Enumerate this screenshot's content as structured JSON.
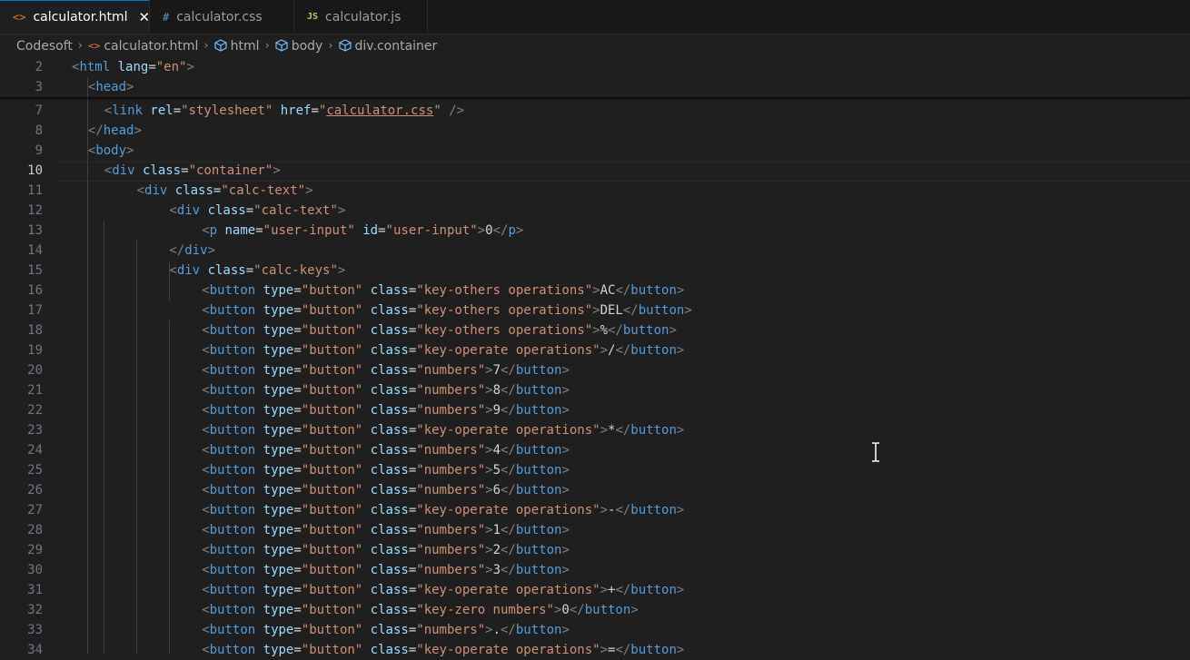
{
  "tabs": [
    {
      "label": "calculator.html",
      "icon": "html-file-icon",
      "icon_glyph": "<>",
      "icon_color": "#e37933",
      "active": true
    },
    {
      "label": "calculator.css",
      "icon": "css-file-icon",
      "icon_glyph": "#",
      "icon_color": "#519aba",
      "active": false
    },
    {
      "label": "calculator.js",
      "icon": "js-file-icon",
      "icon_glyph": "JS",
      "icon_color": "#cbcb41",
      "active": false
    }
  ],
  "breadcrumb": [
    "Codesoft",
    "calculator.html",
    "html",
    "body",
    "div.container"
  ],
  "lines": [
    {
      "num": "2",
      "indent": 0,
      "tokens": [
        [
          "t",
          "<"
        ],
        [
          "tag",
          "html"
        ],
        [
          "txt",
          " "
        ],
        [
          "attr",
          "lang"
        ],
        [
          "txt",
          "="
        ],
        [
          "str",
          "\"en\""
        ],
        [
          "t",
          ">"
        ]
      ]
    },
    {
      "num": "3",
      "indent": 1,
      "tokens": [
        [
          "t",
          "<"
        ],
        [
          "tag",
          "head"
        ],
        [
          "t",
          ">"
        ]
      ]
    },
    {
      "num": "7",
      "indent": 2,
      "tokens": [
        [
          "t",
          "<"
        ],
        [
          "tag",
          "link"
        ],
        [
          "txt",
          " "
        ],
        [
          "attr",
          "rel"
        ],
        [
          "txt",
          "="
        ],
        [
          "str",
          "\"stylesheet\""
        ],
        [
          "txt",
          " "
        ],
        [
          "attr",
          "href"
        ],
        [
          "txt",
          "="
        ],
        [
          "str",
          "\""
        ],
        [
          "strlink",
          "calculator.css"
        ],
        [
          "str",
          "\""
        ],
        [
          "txt",
          " "
        ],
        [
          "t",
          "/>"
        ]
      ]
    },
    {
      "num": "8",
      "indent": 1,
      "tokens": [
        [
          "t",
          "</"
        ],
        [
          "tag",
          "head"
        ],
        [
          "t",
          ">"
        ]
      ]
    },
    {
      "num": "9",
      "indent": 1,
      "tokens": [
        [
          "t",
          "<"
        ],
        [
          "tag",
          "body"
        ],
        [
          "t",
          ">"
        ]
      ]
    },
    {
      "num": "10",
      "indent": 2,
      "current": true,
      "tokens": [
        [
          "t",
          "<"
        ],
        [
          "tag",
          "div"
        ],
        [
          "txt",
          " "
        ],
        [
          "attr",
          "class"
        ],
        [
          "txt",
          "="
        ],
        [
          "str",
          "\"container\""
        ],
        [
          "t",
          ">"
        ]
      ]
    },
    {
      "num": "11",
      "indent": 4,
      "tokens": [
        [
          "t",
          "<"
        ],
        [
          "tag",
          "div"
        ],
        [
          "txt",
          " "
        ],
        [
          "attr",
          "class"
        ],
        [
          "txt",
          "="
        ],
        [
          "str",
          "\"calc-text\""
        ],
        [
          "t",
          ">"
        ]
      ]
    },
    {
      "num": "12",
      "indent": 6,
      "tokens": [
        [
          "t",
          "<"
        ],
        [
          "tag",
          "div"
        ],
        [
          "txt",
          " "
        ],
        [
          "attr",
          "class"
        ],
        [
          "txt",
          "="
        ],
        [
          "str",
          "\"calc-text\""
        ],
        [
          "t",
          ">"
        ]
      ]
    },
    {
      "num": "13",
      "indent": 8,
      "tokens": [
        [
          "t",
          "<"
        ],
        [
          "tag",
          "p"
        ],
        [
          "txt",
          " "
        ],
        [
          "attr",
          "name"
        ],
        [
          "txt",
          "="
        ],
        [
          "str",
          "\"user-input\""
        ],
        [
          "txt",
          " "
        ],
        [
          "attr",
          "id"
        ],
        [
          "txt",
          "="
        ],
        [
          "str",
          "\"user-input\""
        ],
        [
          "t",
          ">"
        ],
        [
          "txt",
          "0"
        ],
        [
          "t",
          "</"
        ],
        [
          "tag",
          "p"
        ],
        [
          "t",
          ">"
        ]
      ]
    },
    {
      "num": "14",
      "indent": 6,
      "tokens": [
        [
          "t",
          "</"
        ],
        [
          "tag",
          "div"
        ],
        [
          "t",
          ">"
        ]
      ]
    },
    {
      "num": "15",
      "indent": 6,
      "tokens": [
        [
          "t",
          "<"
        ],
        [
          "tag",
          "div"
        ],
        [
          "txt",
          " "
        ],
        [
          "attr",
          "class"
        ],
        [
          "txt",
          "="
        ],
        [
          "str",
          "\"calc-keys\""
        ],
        [
          "t",
          ">"
        ]
      ]
    },
    {
      "num": "16",
      "indent": 8,
      "btn": [
        "key-others operations",
        "AC"
      ]
    },
    {
      "num": "17",
      "indent": 8,
      "btn": [
        "key-others operations",
        "DEL"
      ]
    },
    {
      "num": "18",
      "indent": 8,
      "btn": [
        "key-others operations",
        "%"
      ]
    },
    {
      "num": "19",
      "indent": 8,
      "btn": [
        "key-operate operations",
        "/"
      ]
    },
    {
      "num": "20",
      "indent": 8,
      "btn": [
        "numbers",
        "7"
      ]
    },
    {
      "num": "21",
      "indent": 8,
      "btn": [
        "numbers",
        "8"
      ]
    },
    {
      "num": "22",
      "indent": 8,
      "btn": [
        "numbers",
        "9"
      ]
    },
    {
      "num": "23",
      "indent": 8,
      "btn": [
        "key-operate operations",
        "*"
      ]
    },
    {
      "num": "24",
      "indent": 8,
      "btn": [
        "numbers",
        "4"
      ]
    },
    {
      "num": "25",
      "indent": 8,
      "btn": [
        "numbers",
        "5"
      ]
    },
    {
      "num": "26",
      "indent": 8,
      "btn": [
        "numbers",
        "6"
      ]
    },
    {
      "num": "27",
      "indent": 8,
      "btn": [
        "key-operate operations",
        "-"
      ]
    },
    {
      "num": "28",
      "indent": 8,
      "btn": [
        "numbers",
        "1"
      ]
    },
    {
      "num": "29",
      "indent": 8,
      "btn": [
        "numbers",
        "2"
      ]
    },
    {
      "num": "30",
      "indent": 8,
      "btn": [
        "numbers",
        "3"
      ]
    },
    {
      "num": "31",
      "indent": 8,
      "btn": [
        "key-operate operations",
        "+"
      ]
    },
    {
      "num": "32",
      "indent": 8,
      "btn": [
        "key-zero numbers",
        "0"
      ]
    },
    {
      "num": "33",
      "indent": 8,
      "btn": [
        "numbers",
        "."
      ]
    },
    {
      "num": "34",
      "indent": 8,
      "btn": [
        "key-operate operations",
        "="
      ]
    }
  ],
  "colors": {
    "punct": "#808080",
    "tag": "#569cd6",
    "attr": "#9cdcfe",
    "string": "#ce9178",
    "text": "#d4d4d4"
  }
}
